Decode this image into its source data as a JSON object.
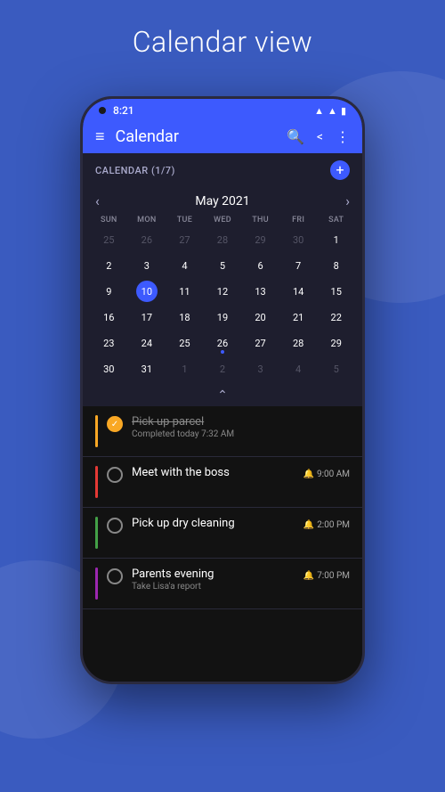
{
  "page": {
    "title": "Calendar view",
    "bg_color": "#3a5bbf"
  },
  "status_bar": {
    "time": "8:21",
    "battery_icon": "🔋",
    "signal_icon": "▲",
    "wifi_icon": "▲"
  },
  "app_bar": {
    "title": "Calendar",
    "menu_icon": "≡",
    "search_icon": "🔍",
    "share_icon": "⊲",
    "more_icon": "⋮"
  },
  "calendar_header": {
    "label": "CALENDAR (1/7)",
    "add_icon": "+"
  },
  "calendar": {
    "month_title": "May 2021",
    "prev_arrow": "‹",
    "next_arrow": "›",
    "day_headers": [
      "SUN",
      "MON",
      "TUE",
      "WED",
      "THU",
      "FRI",
      "SAT"
    ],
    "weeks": [
      [
        {
          "day": "25",
          "other": true
        },
        {
          "day": "26",
          "other": true
        },
        {
          "day": "27",
          "other": true
        },
        {
          "day": "28",
          "other": true
        },
        {
          "day": "29",
          "other": true
        },
        {
          "day": "30",
          "other": true
        },
        {
          "day": "1",
          "other": false
        }
      ],
      [
        {
          "day": "2",
          "other": false
        },
        {
          "day": "3",
          "other": false
        },
        {
          "day": "4",
          "other": false
        },
        {
          "day": "5",
          "other": false
        },
        {
          "day": "6",
          "other": false
        },
        {
          "day": "7",
          "other": false
        },
        {
          "day": "8",
          "other": false
        }
      ],
      [
        {
          "day": "9",
          "other": false
        },
        {
          "day": "10",
          "other": false,
          "today": true
        },
        {
          "day": "11",
          "other": false
        },
        {
          "day": "12",
          "other": false
        },
        {
          "day": "13",
          "other": false
        },
        {
          "day": "14",
          "other": false
        },
        {
          "day": "15",
          "other": false
        }
      ],
      [
        {
          "day": "16",
          "other": false
        },
        {
          "day": "17",
          "other": false
        },
        {
          "day": "18",
          "other": false
        },
        {
          "day": "19",
          "other": false
        },
        {
          "day": "20",
          "other": false
        },
        {
          "day": "21",
          "other": false
        },
        {
          "day": "22",
          "other": false
        }
      ],
      [
        {
          "day": "23",
          "other": false
        },
        {
          "day": "24",
          "other": false
        },
        {
          "day": "25",
          "other": false
        },
        {
          "day": "26",
          "other": false,
          "dot": true
        },
        {
          "day": "27",
          "other": false
        },
        {
          "day": "28",
          "other": false
        },
        {
          "day": "29",
          "other": false
        }
      ],
      [
        {
          "day": "30",
          "other": false
        },
        {
          "day": "31",
          "other": false
        },
        {
          "day": "1",
          "other": true
        },
        {
          "day": "2",
          "other": true
        },
        {
          "day": "3",
          "other": true
        },
        {
          "day": "4",
          "other": true
        },
        {
          "day": "5",
          "other": true
        }
      ]
    ]
  },
  "tasks": [
    {
      "id": "task1",
      "color": "#f9a825",
      "completed": true,
      "title": "Pick up parcel",
      "subtitle": "Completed today 7:32 AM",
      "time": null,
      "check_symbol": "✓"
    },
    {
      "id": "task2",
      "color": "#e53935",
      "completed": false,
      "title": "Meet with the boss",
      "subtitle": null,
      "time": "9:00 AM",
      "time_icon": "🔔"
    },
    {
      "id": "task3",
      "color": "#43a047",
      "completed": false,
      "title": "Pick up dry cleaning",
      "subtitle": null,
      "time": "2:00 PM",
      "time_icon": "🔔"
    },
    {
      "id": "task4",
      "color": "#9c27b0",
      "completed": false,
      "title": "Parents evening",
      "subtitle": "Take Lisa'a report",
      "time": "7:00 PM",
      "time_icon": "🔔"
    }
  ]
}
